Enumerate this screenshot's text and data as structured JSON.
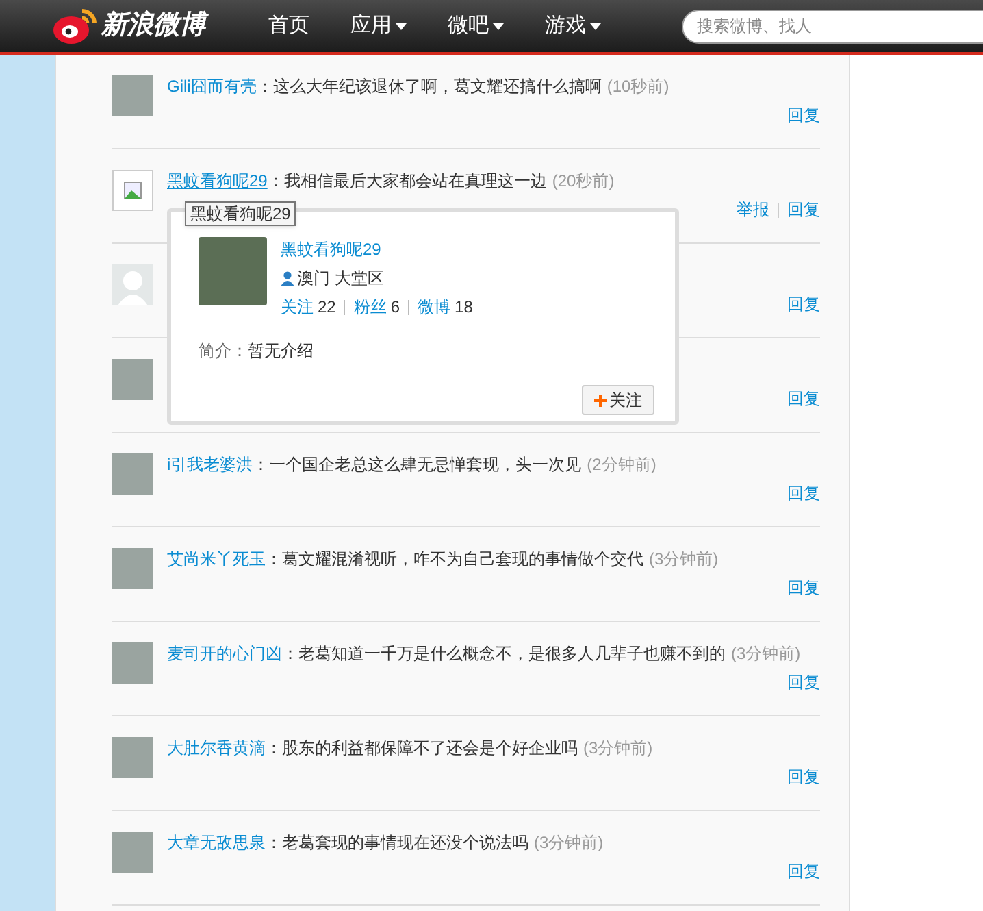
{
  "header": {
    "logo": "新浪微博",
    "nav": [
      {
        "label": "首页",
        "dropdown": false
      },
      {
        "label": "应用",
        "dropdown": true
      },
      {
        "label": "微吧",
        "dropdown": true
      },
      {
        "label": "游戏",
        "dropdown": true
      }
    ],
    "search": {
      "placeholder": "搜索微博、找人"
    }
  },
  "comments": [
    {
      "kind": "photo",
      "name": "Gili囧而有壳",
      "text": "：这么大年纪该退休了啊，葛文耀还搞什么搞啊",
      "time": "(10秒前)",
      "actions": [
        "回复"
      ]
    },
    {
      "kind": "broken",
      "name": "黑蚊看狗呢29",
      "text": "：我相信最后大家都会站在真理这一边",
      "time": "(20秒前)",
      "actions": [
        "举报",
        "回复"
      ]
    },
    {
      "kind": "silhouette",
      "actions": [
        "回复"
      ]
    },
    {
      "kind": "photo",
      "actions": [
        "回复"
      ]
    },
    {
      "kind": "photo",
      "name": "i引我老婆洪",
      "text": "：一个国企老总这么肆无忌惮套现，头一次见",
      "time": "(2分钟前)",
      "actions": [
        "回复"
      ]
    },
    {
      "kind": "photo",
      "name": "艾尚米丫死玉",
      "text": "：葛文耀混淆视听，咋不为自己套现的事情做个交代",
      "time": "(3分钟前)",
      "actions": [
        "回复"
      ]
    },
    {
      "kind": "photo",
      "name": "麦司开的心门凶",
      "text": "：老葛知道一千万是什么概念不，是很多人几辈子也赚不到的",
      "time": "(3分钟前)",
      "actions": [
        "回复"
      ]
    },
    {
      "kind": "photo",
      "name": "大肚尔香黄滴",
      "text": "：股东的利益都保障不了还会是个好企业吗",
      "time": "(3分钟前)",
      "actions": [
        "回复"
      ]
    },
    {
      "kind": "photo",
      "name": "大章无敌思泉",
      "text": "：老葛套现的事情现在还没个说法吗",
      "time": "(3分钟前)",
      "actions": [
        "回复"
      ]
    }
  ],
  "card": {
    "tooltip": "黑蚊看狗呢29",
    "name": "黑蚊看狗呢29",
    "location": "澳门 大堂区",
    "stats": [
      {
        "label": "关注",
        "value": "22"
      },
      {
        "label": "粉丝",
        "value": "6"
      },
      {
        "label": "微博",
        "value": "18"
      }
    ],
    "bio_label": "简介：",
    "bio": "暂无介绍",
    "follow_button": "关注"
  }
}
